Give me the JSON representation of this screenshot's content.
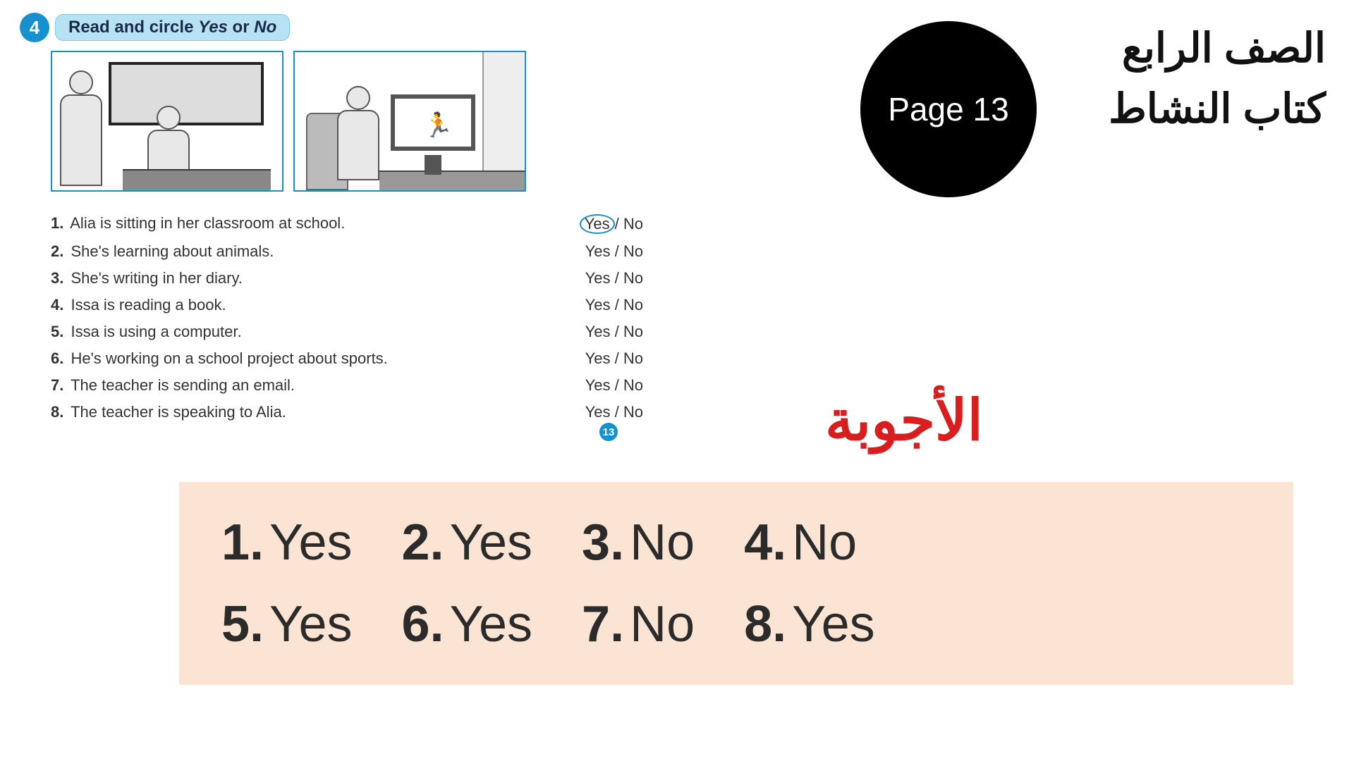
{
  "exercise": {
    "number": "4",
    "title_prefix": "Read and circle ",
    "title_yes": "Yes",
    "title_or": " or ",
    "title_no": "No"
  },
  "questions": [
    {
      "n": "1.",
      "text": " Alia is sitting in her classroom at school.",
      "yes": "Yes",
      "sep": "/ ",
      "no": "No",
      "circled": true
    },
    {
      "n": "2.",
      "text": " She's learning about animals.",
      "yes": "Yes ",
      "sep": "/ ",
      "no": "No",
      "circled": false
    },
    {
      "n": "3.",
      "text": " She's writing in her diary.",
      "yes": "Yes ",
      "sep": "/ ",
      "no": "No",
      "circled": false
    },
    {
      "n": "4.",
      "text": " Issa is reading a book.",
      "yes": "Yes ",
      "sep": "/ ",
      "no": "No",
      "circled": false
    },
    {
      "n": "5.",
      "text": " Issa is using a computer.",
      "yes": "Yes ",
      "sep": "/ ",
      "no": "No",
      "circled": false
    },
    {
      "n": "6.",
      "text": " He's working on a school project about sports.",
      "yes": "Yes ",
      "sep": "/ ",
      "no": "No",
      "circled": false
    },
    {
      "n": "7.",
      "text": " The teacher is sending an email.",
      "yes": "Yes ",
      "sep": "/ ",
      "no": "No",
      "circled": false
    },
    {
      "n": "8.",
      "text": " The teacher is speaking to Alia.",
      "yes": "Yes ",
      "sep": "/ ",
      "no": "No",
      "circled": false
    }
  ],
  "footer_page": "13",
  "badge": {
    "label": "Page 13"
  },
  "arabic": {
    "line1": "الصف الرابع",
    "line2": "كتاب النشاط",
    "answers_heading": "الأجوبة"
  },
  "answers": [
    {
      "n": "1.",
      "v": "Yes"
    },
    {
      "n": "2.",
      "v": "Yes"
    },
    {
      "n": "3.",
      "v": "No"
    },
    {
      "n": "4.",
      "v": "No"
    },
    {
      "n": "5.",
      "v": "Yes"
    },
    {
      "n": "6.",
      "v": "Yes"
    },
    {
      "n": "7.",
      "v": "No"
    },
    {
      "n": "8.",
      "v": "Yes"
    }
  ]
}
